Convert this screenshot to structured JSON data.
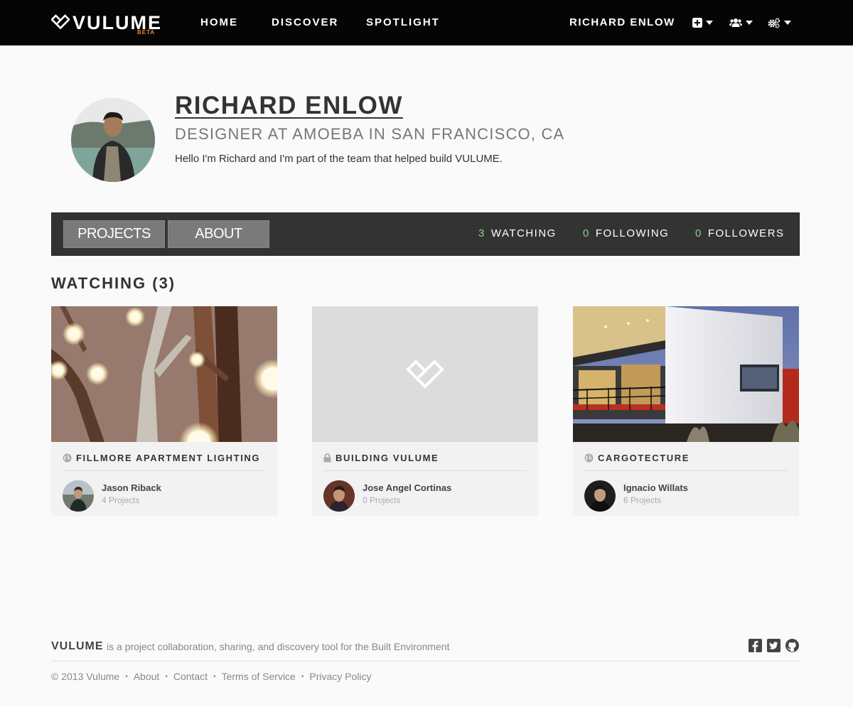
{
  "nav": {
    "logo_text": "VULUME",
    "logo_badge": "BETA",
    "links": [
      "HOME",
      "DISCOVER",
      "SPOTLIGHT"
    ],
    "user_name": "RICHARD ENLOW",
    "icons": [
      "plus-square-icon",
      "users-icon",
      "gears-icon"
    ]
  },
  "profile": {
    "name": "RICHARD ENLOW",
    "subtitle": "DESIGNER AT AMOEBA IN SAN FRANCISCO, CA",
    "bio": "Hello I'm Richard and I'm part of the team that helped build VULUME."
  },
  "tabs": {
    "items": [
      "PROJECTS",
      "ABOUT"
    ],
    "stats": [
      {
        "count": "3",
        "label": "WATCHING"
      },
      {
        "count": "0",
        "label": "FOLLOWING"
      },
      {
        "count": "0",
        "label": "FOLLOWERS"
      }
    ]
  },
  "watching": {
    "title": "WATCHING (3)",
    "projects": [
      {
        "title": "FILLMORE APARTMENT LIGHTING",
        "visibility_icon": "globe-icon",
        "owner": "Jason Riback",
        "owner_projects": "4 Projects"
      },
      {
        "title": "BUILDING VULUME",
        "visibility_icon": "lock-icon",
        "owner": "Jose Angel Cortinas",
        "owner_projects": "0 Projects"
      },
      {
        "title": "CARGOTECTURE",
        "visibility_icon": "globe-icon",
        "owner": "Ignacio Willats",
        "owner_projects": "6 Projects"
      }
    ]
  },
  "footer": {
    "brand": "VULUME",
    "tagline": "is a project collaboration, sharing, and discovery tool for the Built Environment",
    "copyright": "© 2013 Vulume",
    "links": [
      "About",
      "Contact",
      "Terms of Service",
      "Privacy Policy"
    ],
    "social": [
      "facebook-icon",
      "twitter-icon",
      "github-icon"
    ]
  },
  "colors": {
    "nav_bg": "#050505",
    "accent_beta": "#e8862c",
    "stat_count": "#8cd08c",
    "tabbar_bg": "#333333"
  }
}
